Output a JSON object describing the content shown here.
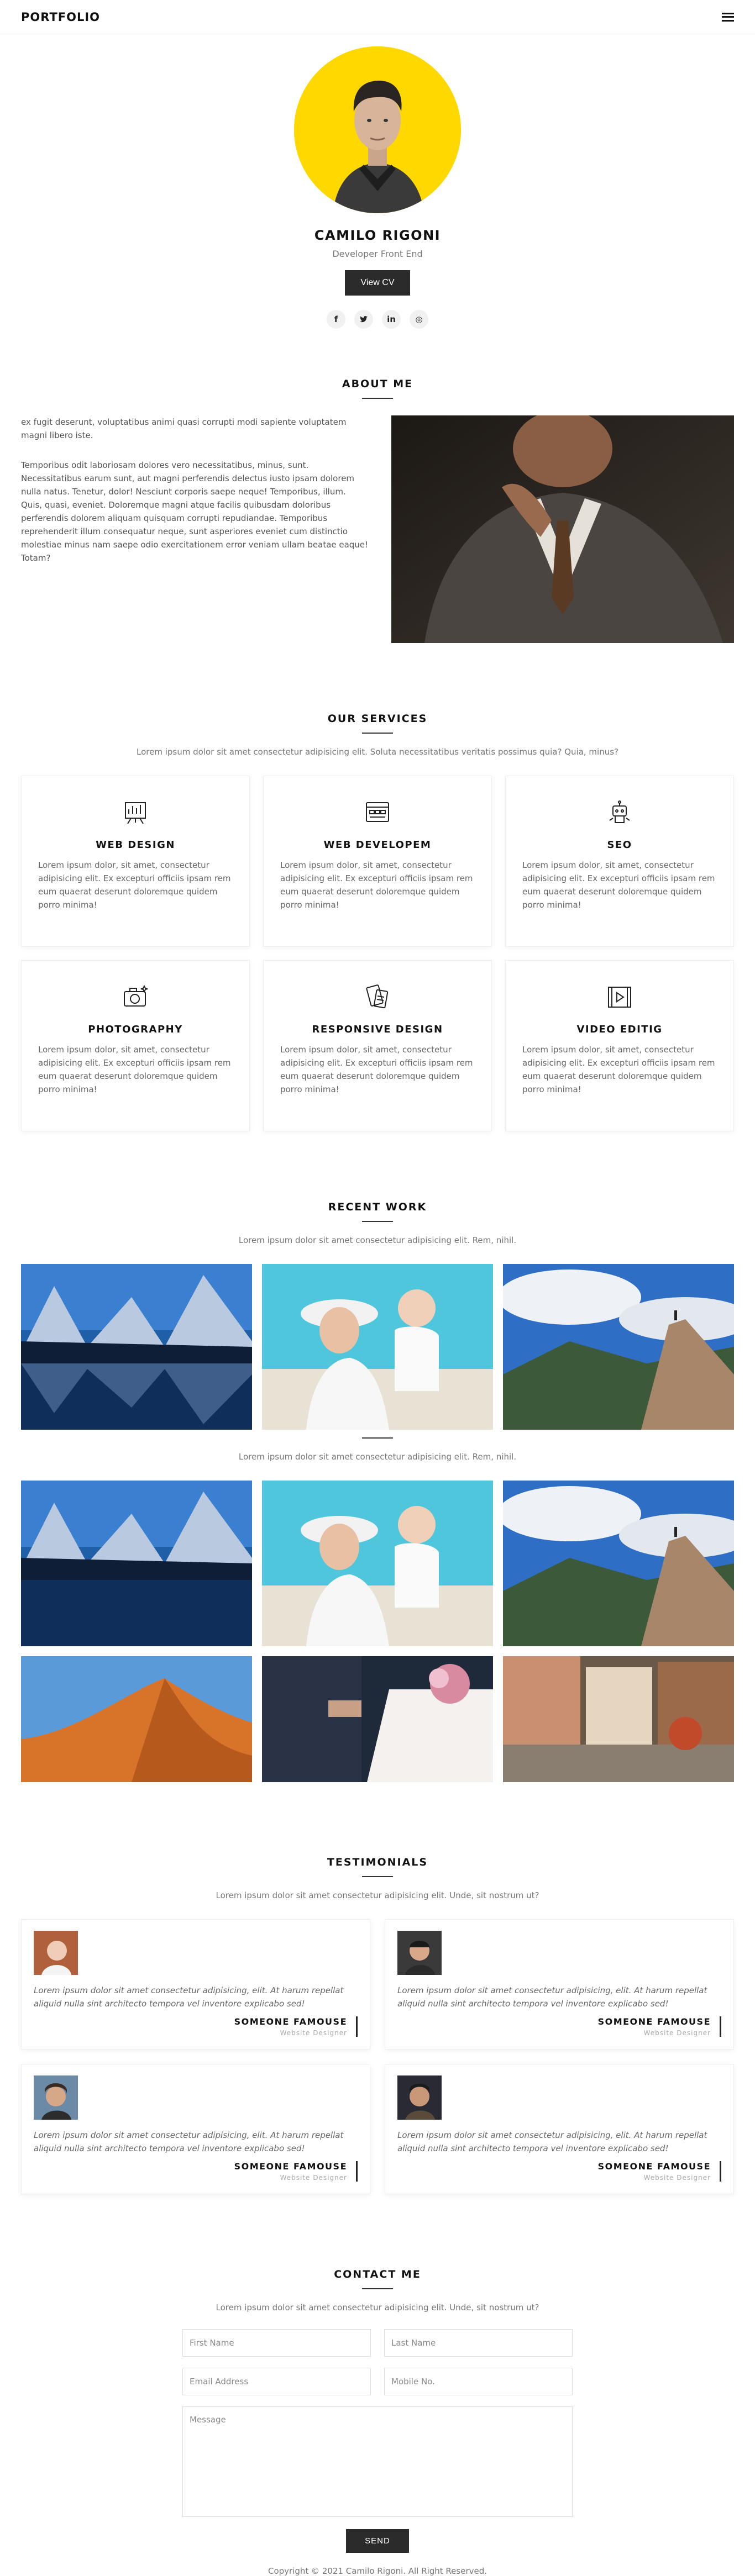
{
  "nav": {
    "brand": "PORTFOLIO",
    "menu_icon": "hamburger-menu-icon"
  },
  "hero": {
    "name": "CAMILO RIGONI",
    "role": "Developer Front End",
    "cta": "View CV",
    "accent": "#ffd800",
    "socials": [
      {
        "icon": "facebook-icon",
        "glyph": "f"
      },
      {
        "icon": "twitter-icon",
        "glyph": "t"
      },
      {
        "icon": "linkedin-icon",
        "glyph": "in"
      },
      {
        "icon": "instagram-icon",
        "glyph": "◎"
      }
    ]
  },
  "about": {
    "title": "ABOUT ME",
    "p1": "ex fugit deserunt, voluptatibus animi quasi corrupti modi sapiente voluptatem magni libero iste.",
    "p2": "Temporibus odit laboriosam dolores vero necessitatibus, minus, sunt. Necessitatibus earum sunt, aut magni perferendis delectus iusto ipsam dolorem nulla natus. Tenetur, dolor! Nesciunt corporis saepe neque! Temporibus, illum. Quis, quasi, eveniet. Doloremque magni atque facilis quibusdam doloribus perferendis dolorem aliquam quisquam corrupti repudiandae. Temporibus reprehenderit illum consequatur neque, sunt asperiores eveniet cum distinctio molestiae minus nam saepe odio exercitationem error veniam ullam beatae eaque! Totam?"
  },
  "services": {
    "title": "OUR SERVICES",
    "subtitle": "Lorem ipsum dolor sit amet consectetur adipisicing elit. Soluta necessitatibus veritatis possimus quia? Quia, minus?",
    "items": [
      {
        "name": "WEB DESIGN",
        "icon": "presentation-icon",
        "text": "Lorem ipsum dolor, sit amet, consectetur adipisicing elit. Ex excepturi officiis ipsam rem eum quaerat deserunt doloremque quidem porro minima!"
      },
      {
        "name": "WEB DEVELOPEM",
        "icon": "browser-code-icon",
        "text": "Lorem ipsum dolor, sit amet, consectetur adipisicing elit. Ex excepturi officiis ipsam rem eum quaerat deserunt doloremque quidem porro minima!"
      },
      {
        "name": "SEO",
        "icon": "robot-icon",
        "text": "Lorem ipsum dolor, sit amet, consectetur adipisicing elit. Ex excepturi officiis ipsam rem eum quaerat deserunt doloremque quidem porro minima!"
      },
      {
        "name": "PHOTOGRAPHY",
        "icon": "camera-icon",
        "text": "Lorem ipsum dolor, sit amet, consectetur adipisicing elit. Ex excepturi officiis ipsam rem eum quaerat deserunt doloremque quidem porro minima!"
      },
      {
        "name": "RESPONSIVE DESIGN",
        "icon": "devices-icon",
        "text": "Lorem ipsum dolor, sit amet, consectetur adipisicing elit. Ex excepturi officiis ipsam rem eum quaerat deserunt doloremque quidem porro minima!"
      },
      {
        "name": "VIDEO EDITIG",
        "icon": "video-icon",
        "text": "Lorem ipsum dolor, sit amet, consectetur adipisicing elit. Ex excepturi officiis ipsam rem eum quaerat deserunt doloremque quidem porro minima!"
      }
    ]
  },
  "work": {
    "title": "RECENT WORK",
    "subtitle": "Lorem ipsum dolor sit amet consectetur adipisicing elit. Rem, nihil.",
    "subtitle2": "Lorem ipsum dolor sit amet consectetur adipisicing elit. Rem, nihil."
  },
  "testimonials": {
    "title": "TESTIMONIALS",
    "subtitle": "Lorem ipsum dolor sit amet consectetur adipisicing elit. Unde, sit nostrum ut?",
    "items": [
      {
        "quote": "Lorem ipsum dolor sit amet consectetur adipisicing, elit. At harum repellat aliquid nulla sint architecto tempora vel inventore explicabo sed!",
        "name": "SOMEONE FAMOUSE",
        "role": "Website Designer"
      },
      {
        "quote": "Lorem ipsum dolor sit amet consectetur adipisicing, elit. At harum repellat aliquid nulla sint architecto tempora vel inventore explicabo sed!",
        "name": "SOMEONE FAMOUSE",
        "role": "Website Designer"
      },
      {
        "quote": "Lorem ipsum dolor sit amet consectetur adipisicing, elit. At harum repellat aliquid nulla sint architecto tempora vel inventore explicabo sed!",
        "name": "SOMEONE FAMOUSE",
        "role": "Website Designer"
      },
      {
        "quote": "Lorem ipsum dolor sit amet consectetur adipisicing, elit. At harum repellat aliquid nulla sint architecto tempora vel inventore explicabo sed!",
        "name": "SOMEONE FAMOUSE",
        "role": "Website Designer"
      }
    ]
  },
  "contact": {
    "title": "CONTACT ME",
    "subtitle": "Lorem ipsum dolor sit amet consectetur adipisicing elit. Unde, sit nostrum ut?",
    "first_name": "First Name",
    "last_name": "Last Name",
    "email": "Email Address",
    "mobile": "Mobile No.",
    "message": "Message",
    "send": "SEND"
  },
  "footer": {
    "copyright": "Copyright © 2021 Camilo Rigoni. All Right Reserved."
  }
}
